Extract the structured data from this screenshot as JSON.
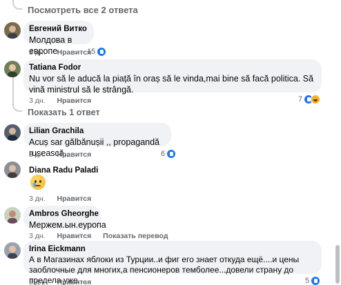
{
  "view_replies": {
    "label": "Посмотреть все 2 ответа"
  },
  "show_reply": {
    "label": "Показать 1 ответ"
  },
  "comments": [
    {
      "author": "Евгений Витко",
      "text": "Молдова в европе",
      "time": "3 дн.",
      "like": "Нравится",
      "reactions": "15"
    },
    {
      "author": "Tatiana Fodor",
      "text": "Nu vor să le aducă la piață în oraș să le vinda,mai bine să facă politica. Să vină ministrul să le strângă.",
      "time": "3 дн.",
      "like": "Нравится",
      "reactions": "7"
    },
    {
      "author": "Lilian Grachila",
      "text": "Acuș sar gălbănușii ,, propagandă rusească,,",
      "time": "3 дн.",
      "like": "Нравится",
      "reactions": "6"
    },
    {
      "author": "Diana Radu Paladi",
      "text": "",
      "time": "3 дн.",
      "like": "Нравится",
      "reactions": ""
    },
    {
      "author": "Ambros Gheorghe",
      "text": "Мержем.ын.еуропа",
      "time": "3 дн.",
      "like": "Нравится",
      "translate": "Показать перевод",
      "reactions": ""
    },
    {
      "author": "Irina Eickmann",
      "text": "А в Магазинах яблоки из Турции..и фиг его знает откуда ещё....и цены заоблочные для многих,а пенсионеров темболее...довели страну до предела уже....",
      "time": "3 дн.",
      "like": "Нравится",
      "reactions": "5"
    }
  ],
  "icons": {
    "like": "like-reaction-icon",
    "haha": "haha-reaction-icon",
    "cry": "crying-face-emoji"
  },
  "colors": {
    "bubble": "#f0f2f5",
    "meta": "#65676b",
    "like_blue": "#1877f2"
  }
}
